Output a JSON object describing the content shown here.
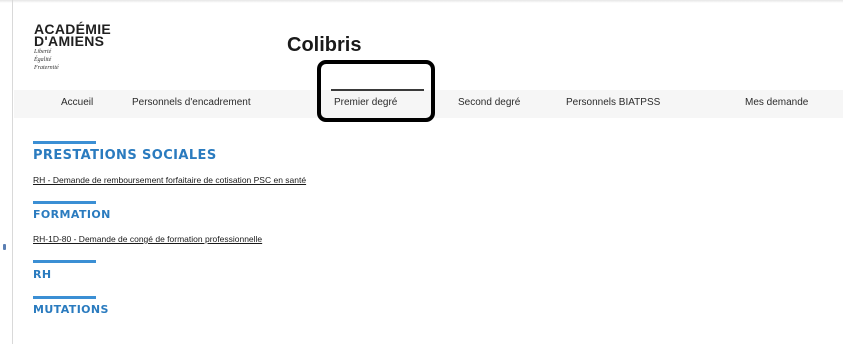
{
  "logo": {
    "line1": "ACADÉMIE",
    "line2": "D'AMIENS",
    "motto1": "Liberté",
    "motto2": "Égalité",
    "motto3": "Fraternité"
  },
  "app_title": "Colibris",
  "nav": {
    "items": [
      {
        "label": "Accueil"
      },
      {
        "label": "Personnels d'encadrement"
      },
      {
        "label": "Premier degré",
        "active": true
      },
      {
        "label": "Second degré"
      },
      {
        "label": "Personnels BIATPSS"
      },
      {
        "label": "Mes demande"
      }
    ]
  },
  "sections": [
    {
      "title": "PRESTATIONS SOCIALES",
      "links": [
        "RH - Demande de remboursement forfaitaire de cotisation PSC en santé"
      ]
    },
    {
      "title": "FORMATION",
      "links": [
        "RH-1D-80 - Demande de congé de formation professionnelle"
      ]
    },
    {
      "title": "RH",
      "links": []
    },
    {
      "title": "MUTATIONS",
      "links": []
    }
  ],
  "colors": {
    "accent": "#2a7bbf",
    "section_bar": "#3b8fd4",
    "highlight_box": "#000000",
    "nav_background": "#f6f6f6"
  }
}
